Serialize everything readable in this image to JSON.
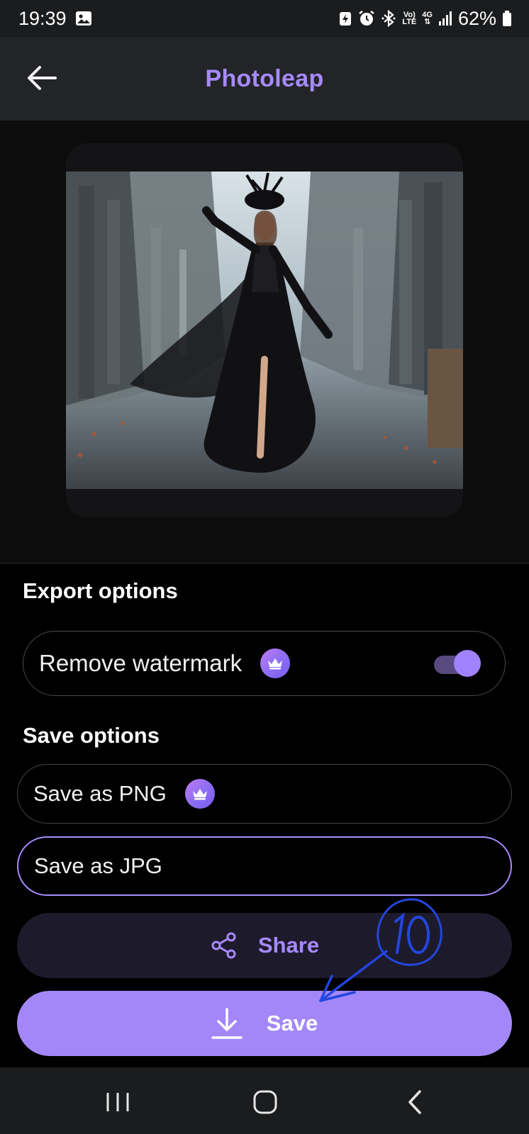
{
  "status_bar": {
    "time": "19:39",
    "volte_top": "Vo)",
    "volte_bottom": "LTE",
    "network": "4G",
    "battery": "62%",
    "icons": [
      "gallery-icon",
      "battery-saver-icon",
      "alarm-icon",
      "bluetooth-icon",
      "volte-icon",
      "4g-icon",
      "signal-icon",
      "battery-icon"
    ]
  },
  "app_bar": {
    "title": "Photoleap",
    "back_icon": "arrow-left-icon"
  },
  "preview": {
    "image_icon": "generated-image"
  },
  "export_options": {
    "title": "Export options",
    "remove_watermark": {
      "label": "Remove watermark",
      "enabled": true,
      "premium": true
    }
  },
  "save_options": {
    "title": "Save options",
    "items": [
      {
        "label": "Save as PNG",
        "premium": true,
        "selected": false
      },
      {
        "label": "Save as JPG",
        "premium": false,
        "selected": true
      }
    ]
  },
  "actions": {
    "share_label": "Share",
    "save_label": "Save"
  },
  "annotation": {
    "text": "10",
    "color": "#2346e0"
  },
  "colors": {
    "accent": "#a68aff",
    "save_button": "#a387f8",
    "share_button_bg": "#1d1a2b",
    "toolbar_bg": "#232427"
  },
  "nav_bar": {
    "icons": [
      "recents-icon",
      "home-icon",
      "back-icon"
    ]
  }
}
